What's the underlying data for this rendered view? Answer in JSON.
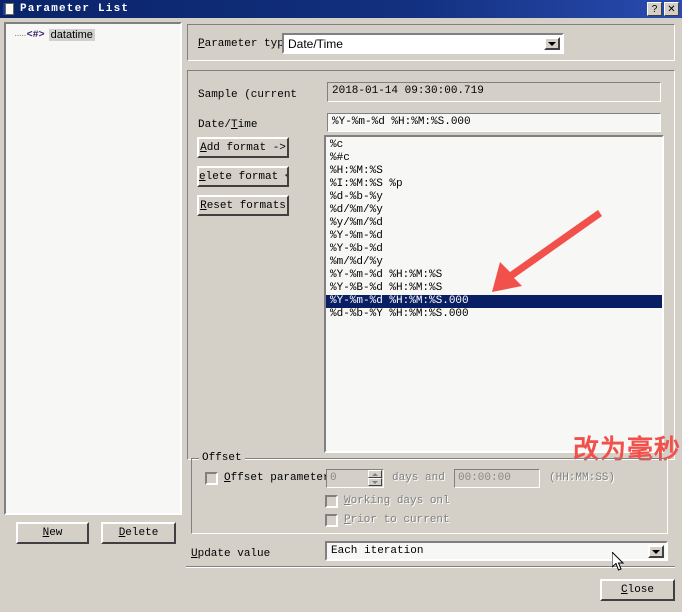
{
  "window": {
    "title": "Parameter List",
    "icon": "document-icon",
    "help_button": "?",
    "close_button": "✕"
  },
  "tree": {
    "items": [
      {
        "tag": "<#>",
        "label": "datatime",
        "selected": true
      }
    ],
    "new_button": "New",
    "delete_button": "Delete"
  },
  "parameter_type": {
    "label": "Parameter type:",
    "label_mnemonic": "P",
    "value": "Date/Time",
    "options": [
      "Date/Time"
    ]
  },
  "sample": {
    "label": "Sample (current",
    "value": "2018-01-14 09:30:00.719"
  },
  "date_time": {
    "label": "Date/Time",
    "label_mnemonic": "T",
    "value": "%Y-%m-%d %H:%M:%S.000"
  },
  "format_buttons": {
    "add": "Add format ->",
    "delete": "elete format <",
    "reset": "Reset formats"
  },
  "format_list": {
    "items": [
      "%c",
      "%#c",
      "%H:%M:%S",
      "%I:%M:%S %p",
      "%d-%b-%y",
      "%d/%m/%y",
      "%y/%m/%d",
      "%Y-%m-%d",
      "%Y-%b-%d",
      "%m/%d/%y",
      "%Y-%m-%d %H:%M:%S",
      "%Y-%B-%d %H:%M:%S",
      "%Y-%m-%d %H:%M:%S.000",
      "%d-%b-%Y %H:%M:%S.000"
    ],
    "selected_index": 12
  },
  "annotation": {
    "text": "改为毫秒",
    "color": "#f2504b",
    "arrow_color": "#f2504b"
  },
  "offset": {
    "group_label": "Offset",
    "checkbox_label": "Offset parameter",
    "checkbox_mnemonic": "O",
    "checked": false,
    "days_value": "0",
    "days_and_label": "days and",
    "time_value": "00:00:00",
    "time_hint": "(HH:MM:SS)",
    "working_days_label": "Working days onl",
    "working_days_checked": false,
    "prior_label": "Prior to current",
    "prior_checked": false
  },
  "update_value": {
    "label": "Update value",
    "label_mnemonic": "U",
    "value": "Each iteration",
    "options": [
      "Each iteration"
    ]
  },
  "footer": {
    "close_button": "Close"
  },
  "colors": {
    "titlebar": "#0a246a",
    "face": "#d4d0c8",
    "selection": "#0a1f63",
    "accent_red": "#f2504b"
  }
}
